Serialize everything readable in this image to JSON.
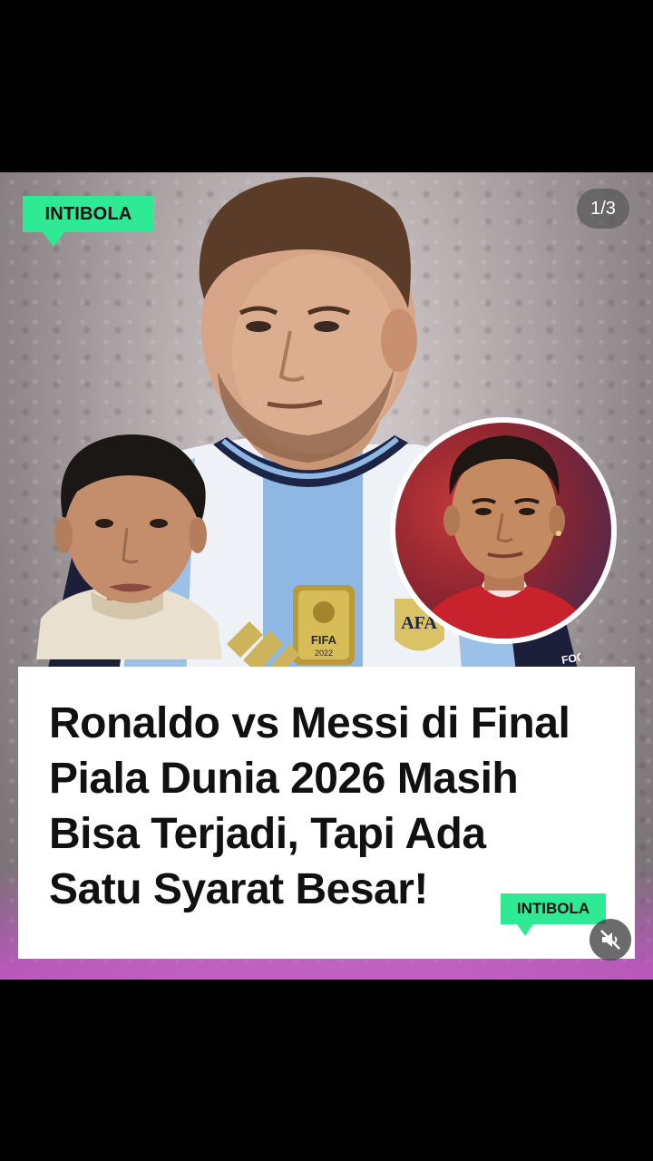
{
  "post": {
    "brand_tag": "INTIBOLA",
    "slide_counter": "1/3",
    "headline": "Ronaldo vs Messi di Final\nPiala Dunia 2026 Masih\nBisa Terjadi, Tapi Ada\nSatu Syarat Besar!",
    "brand_tag_bottom": "INTIBOLA",
    "badge_text": "FIFA",
    "badge_year": "2022",
    "crest_text": "AFA",
    "sleeve_text": "FOOTB"
  },
  "controls": {
    "mute_icon": "speaker-muted-icon"
  },
  "colors": {
    "brand_green": "#2fea94",
    "background": "#000000",
    "headline_text": "#111111"
  }
}
